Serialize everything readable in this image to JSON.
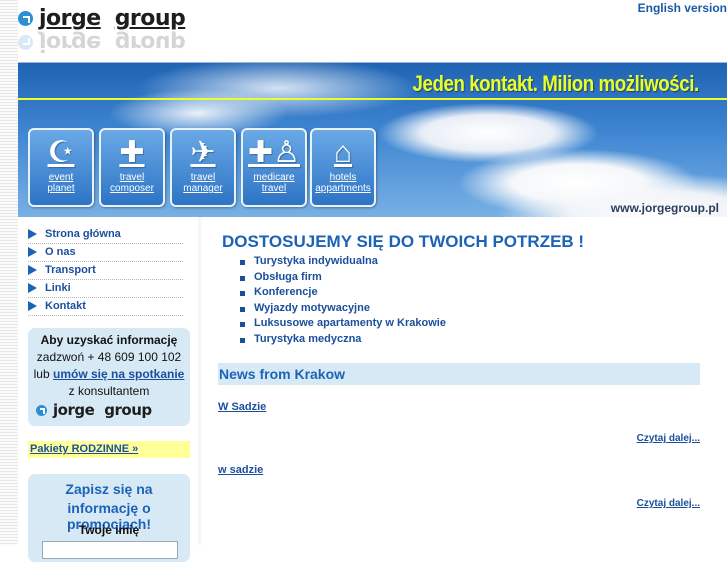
{
  "header": {
    "logo_text_1": "jorge",
    "logo_text_2": "group",
    "language_link": "English version"
  },
  "banner": {
    "slogan": "Jeden kontakt. Milion możliwości.",
    "url": "www.jorgegroup.pl",
    "tiles": [
      {
        "icon": "moon-star-icon",
        "label_1": "event",
        "label_2": "planet"
      },
      {
        "icon": "puzzle-icon",
        "label_1": "travel",
        "label_2": "composer"
      },
      {
        "icon": "airplane-icon",
        "label_1": "travel",
        "label_2": "manager"
      },
      {
        "icon": "medical-cross-person-icon",
        "label_1": "medicare",
        "label_2": "travel"
      },
      {
        "icon": "house-icon",
        "label_1": "hotels",
        "label_2": "appartments"
      }
    ]
  },
  "sidebar": {
    "nav": [
      "Strona główna",
      "O nas",
      "Transport",
      "Linki",
      "Kontakt"
    ],
    "contact": {
      "line1": "Aby uzyskać informację",
      "line2": "zadzwoń + 48 609 100 102",
      "line3_prefix": "lub",
      "line3_link": "umów się na spotkanie",
      "line4": "z konsultantem",
      "logo_1": "jorge",
      "logo_2": "group"
    },
    "family_link": "Pakiety RODZINNE »",
    "promo": {
      "title_1": "Zapisz się na",
      "title_2": "informację o promocjach!",
      "name_label": "Twoje imię",
      "name_value": ""
    }
  },
  "main": {
    "title": "DOSTOSUJEMY SIĘ DO TWOICH POTRZEB !",
    "services": [
      "Turystyka indywidualna",
      "Obsługa firm",
      "Konferencje",
      "Wyjazdy motywacyjne",
      "Luksusowe apartamenty w Krakowie",
      "Turystyka medyczna"
    ],
    "news_header": "News from Krakow",
    "news": [
      {
        "title": "W Sadzie",
        "more": "Czytaj dalej..."
      },
      {
        "title": "w sadzie",
        "more": "Czytaj dalej..."
      }
    ]
  },
  "colors": {
    "brand_blue": "#1c63b8",
    "link_blue": "#1b4f9c",
    "box_blue": "#d8e9f6",
    "slogan_yellow": "#e8ff2a",
    "family_yellow": "#ffff99"
  }
}
